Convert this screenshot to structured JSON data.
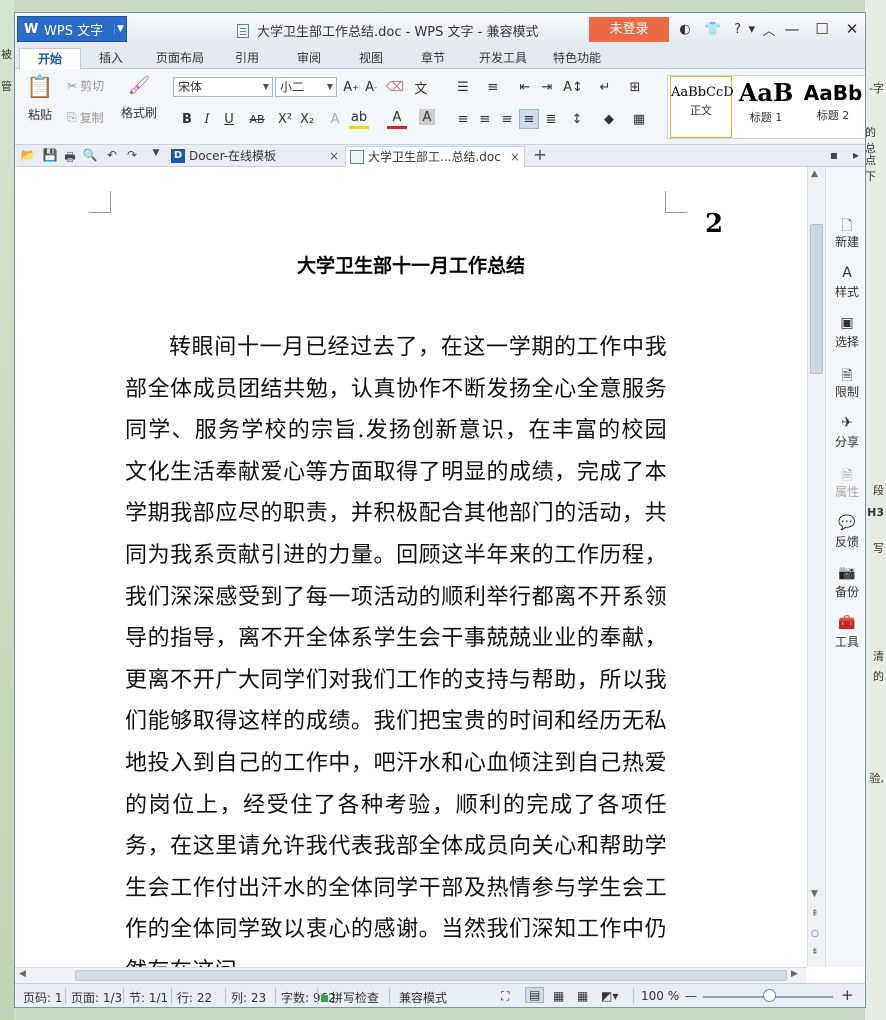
{
  "background": {
    "left_fragments": [
      "被",
      "管"
    ],
    "right_fragments": [
      "-字",
      "的总",
      "点下",
      "段",
      "H3",
      "写",
      "清",
      "的",
      "验,"
    ]
  },
  "titlebar": {
    "app_label": "WPS 文字",
    "doc_title": "大学卫生部工作总结.doc - WPS 文字 - 兼容模式",
    "login": "未登录",
    "help": "?"
  },
  "ribbon_tabs": [
    "开始",
    "插入",
    "页面布局",
    "引用",
    "审阅",
    "视图",
    "章节",
    "开发工具",
    "特色功能"
  ],
  "ribbon": {
    "paste": "粘贴",
    "cut": "剪切",
    "copy": "复制",
    "format_painter": "格式刷",
    "font_name": "宋体",
    "font_size": "小二",
    "styles": [
      {
        "preview": "AaBbCcD",
        "label": "正文"
      },
      {
        "preview": "AaB",
        "label": "标题 1"
      },
      {
        "preview": "AaBb",
        "label": "标题 2"
      }
    ]
  },
  "doc_tabs": [
    {
      "label": "Docer-在线模板"
    },
    {
      "label": "大学卫生部工...总结.doc"
    }
  ],
  "document": {
    "page_number": "2",
    "title": "大学卫生部十一月工作总结",
    "body": "转眼间十一月已经过去了，在这一学期的工作中我部全体成员团结共勉，认真协作不断发扬全心全意服务同学、服务学校的宗旨.发扬创新意识，在丰富的校园文化生活奉献爱心等方面取得了明显的成绩，完成了本学期我部应尽的职责，并积极配合其他部门的活动，共同为我系贡献引进的力量。回顾这半年来的工作历程，我们深深感受到了每一项活动的顺利举行都离不开系领导的指导，离不开全体系学生会干事兢兢业业的奉献，更离不开广大同学们对我们工作的支持与帮助，所以我们能够取得这样的成绩。我们把宝贵的时间和经历无私地投入到自己的工作中，吧汗水和心血倾注到自己热爱的岗位上，经受住了各种考验，顺利的完成了各项任务，在这里请允许我代表我部全体成员向关心和帮助学生会工作付出汗水的全体同学干部及热情参与学生会工作的全体同学致以衷心的感谢。当然我们深知工作中仍然存在这问"
  },
  "right_pane": [
    "新建",
    "样式",
    "选择",
    "限制",
    "分享",
    "属性",
    "反馈",
    "备份",
    "工具"
  ],
  "statusbar": {
    "page_code": "页码: 1",
    "pages": "页面: 1/3",
    "section": "节: 1/1",
    "row": "行: 22",
    "col": "列: 23",
    "words": "字数: 962",
    "spell": "拼写检查",
    "mode": "兼容模式",
    "zoom": "100 %"
  }
}
